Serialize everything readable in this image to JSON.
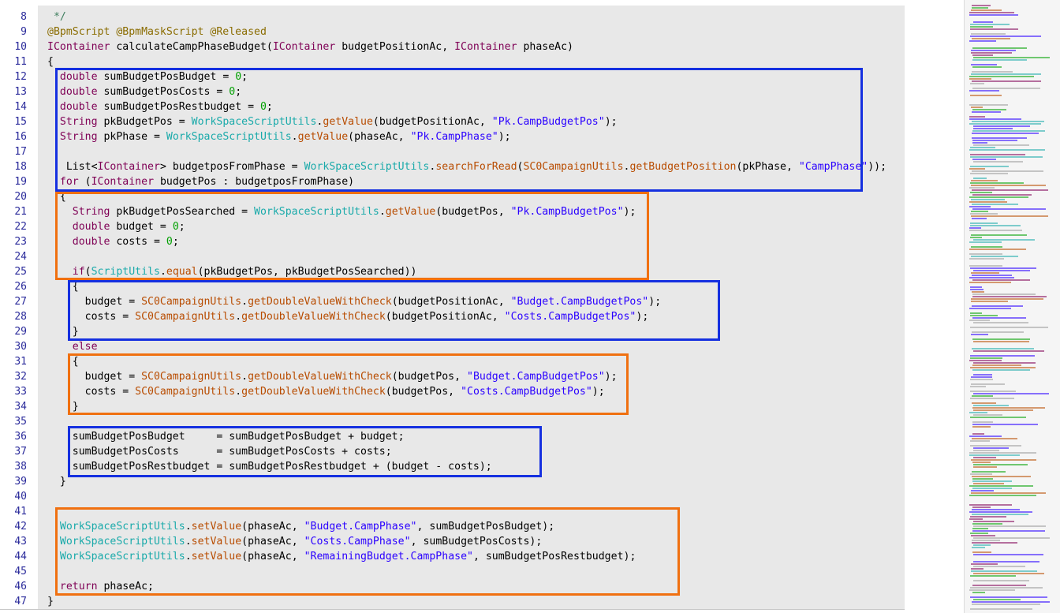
{
  "colors": {
    "background": "#e8e8e8",
    "keyword": "#7f0055",
    "number": "#00a000",
    "string": "#2a00ff",
    "utilClass": "#1aaaaa",
    "campaignClass": "#b84c00",
    "annotation": "#8a6c00",
    "highlightBlue": "#1530e0",
    "highlightOrange": "#f07010"
  },
  "lines": [
    {
      "n": "8",
      "tokens": [
        {
          "t": " */",
          "c": "cmt"
        }
      ]
    },
    {
      "n": "9",
      "tokens": [
        {
          "t": "@BpmScript @BpmMaskScript @Released",
          "c": "ann"
        }
      ]
    },
    {
      "n": "10",
      "tokens": [
        {
          "t": "IContainer",
          "c": "tp"
        },
        {
          "t": " calculateCampPhaseBudget(",
          "c": ""
        },
        {
          "t": "IContainer",
          "c": "tp"
        },
        {
          "t": " budgetPositionAc, ",
          "c": ""
        },
        {
          "t": "IContainer",
          "c": "tp"
        },
        {
          "t": " phaseAc)",
          "c": ""
        }
      ]
    },
    {
      "n": "11",
      "tokens": [
        {
          "t": "{",
          "c": ""
        }
      ]
    },
    {
      "n": "12",
      "tokens": [
        {
          "t": "  ",
          "c": ""
        },
        {
          "t": "double",
          "c": "kw"
        },
        {
          "t": " sumBudgetPosBudget = ",
          "c": ""
        },
        {
          "t": "0",
          "c": "num"
        },
        {
          "t": ";",
          "c": ""
        }
      ]
    },
    {
      "n": "13",
      "tokens": [
        {
          "t": "  ",
          "c": ""
        },
        {
          "t": "double",
          "c": "kw"
        },
        {
          "t": " sumBudgetPosCosts = ",
          "c": ""
        },
        {
          "t": "0",
          "c": "num"
        },
        {
          "t": ";",
          "c": ""
        }
      ]
    },
    {
      "n": "14",
      "tokens": [
        {
          "t": "  ",
          "c": ""
        },
        {
          "t": "double",
          "c": "kw"
        },
        {
          "t": " sumBudgetPosRestbudget = ",
          "c": ""
        },
        {
          "t": "0",
          "c": "num"
        },
        {
          "t": ";",
          "c": ""
        }
      ]
    },
    {
      "n": "15",
      "tokens": [
        {
          "t": "  ",
          "c": ""
        },
        {
          "t": "String",
          "c": "tp"
        },
        {
          "t": " pkBudgetPos = ",
          "c": ""
        },
        {
          "t": "WorkSpaceScriptUtils",
          "c": "cls"
        },
        {
          "t": ".",
          "c": ""
        },
        {
          "t": "getValue",
          "c": "cls2"
        },
        {
          "t": "(budgetPositionAc, ",
          "c": ""
        },
        {
          "t": "\"Pk.CampBudgetPos\"",
          "c": "str"
        },
        {
          "t": ");",
          "c": ""
        }
      ]
    },
    {
      "n": "16",
      "tokens": [
        {
          "t": "  ",
          "c": ""
        },
        {
          "t": "String",
          "c": "tp"
        },
        {
          "t": " pkPhase = ",
          "c": ""
        },
        {
          "t": "WorkSpaceScriptUtils",
          "c": "cls"
        },
        {
          "t": ".",
          "c": ""
        },
        {
          "t": "getValue",
          "c": "cls2"
        },
        {
          "t": "(phaseAc, ",
          "c": ""
        },
        {
          "t": "\"Pk.CampPhase\"",
          "c": "str"
        },
        {
          "t": ");",
          "c": ""
        }
      ]
    },
    {
      "n": "17",
      "tokens": []
    },
    {
      "n": "18",
      "tokens": [
        {
          "t": "   List<",
          "c": ""
        },
        {
          "t": "IContainer",
          "c": "tp"
        },
        {
          "t": "> budgetposFromPhase = ",
          "c": ""
        },
        {
          "t": "WorkSpaceScriptUtils",
          "c": "cls"
        },
        {
          "t": ".",
          "c": ""
        },
        {
          "t": "searchForRead",
          "c": "cls2"
        },
        {
          "t": "(",
          "c": ""
        },
        {
          "t": "SC0CampaignUtils",
          "c": "cls2"
        },
        {
          "t": ".",
          "c": ""
        },
        {
          "t": "getBudgetPosition",
          "c": "cls2"
        },
        {
          "t": "(pkPhase, ",
          "c": ""
        },
        {
          "t": "\"CampPhase\"",
          "c": "str"
        },
        {
          "t": "));",
          "c": ""
        }
      ]
    },
    {
      "n": "19",
      "tokens": [
        {
          "t": "  ",
          "c": ""
        },
        {
          "t": "for",
          "c": "kw"
        },
        {
          "t": " (",
          "c": ""
        },
        {
          "t": "IContainer",
          "c": "tp"
        },
        {
          "t": " budgetPos : budgetposFromPhase)",
          "c": ""
        }
      ]
    },
    {
      "n": "20",
      "tokens": [
        {
          "t": "  {",
          "c": ""
        }
      ]
    },
    {
      "n": "21",
      "tokens": [
        {
          "t": "    ",
          "c": ""
        },
        {
          "t": "String",
          "c": "tp"
        },
        {
          "t": " pkBudgetPosSearched = ",
          "c": ""
        },
        {
          "t": "WorkSpaceScriptUtils",
          "c": "cls"
        },
        {
          "t": ".",
          "c": ""
        },
        {
          "t": "getValue",
          "c": "cls2"
        },
        {
          "t": "(budgetPos, ",
          "c": ""
        },
        {
          "t": "\"Pk.CampBudgetPos\"",
          "c": "str"
        },
        {
          "t": ");",
          "c": ""
        }
      ]
    },
    {
      "n": "22",
      "tokens": [
        {
          "t": "    ",
          "c": ""
        },
        {
          "t": "double",
          "c": "kw"
        },
        {
          "t": " budget = ",
          "c": ""
        },
        {
          "t": "0",
          "c": "num"
        },
        {
          "t": ";",
          "c": ""
        }
      ]
    },
    {
      "n": "23",
      "tokens": [
        {
          "t": "    ",
          "c": ""
        },
        {
          "t": "double",
          "c": "kw"
        },
        {
          "t": " costs = ",
          "c": ""
        },
        {
          "t": "0",
          "c": "num"
        },
        {
          "t": ";",
          "c": ""
        }
      ]
    },
    {
      "n": "24",
      "tokens": []
    },
    {
      "n": "25",
      "tokens": [
        {
          "t": "    ",
          "c": ""
        },
        {
          "t": "if",
          "c": "kw"
        },
        {
          "t": "(",
          "c": ""
        },
        {
          "t": "ScriptUtils",
          "c": "cls"
        },
        {
          "t": ".",
          "c": ""
        },
        {
          "t": "equal",
          "c": "cls2"
        },
        {
          "t": "(pkBudgetPos, pkBudgetPosSearched))",
          "c": ""
        }
      ]
    },
    {
      "n": "26",
      "tokens": [
        {
          "t": "    {",
          "c": ""
        }
      ]
    },
    {
      "n": "27",
      "tokens": [
        {
          "t": "      budget = ",
          "c": ""
        },
        {
          "t": "SC0CampaignUtils",
          "c": "cls2"
        },
        {
          "t": ".",
          "c": ""
        },
        {
          "t": "getDoubleValueWithCheck",
          "c": "cls2"
        },
        {
          "t": "(budgetPositionAc, ",
          "c": ""
        },
        {
          "t": "\"Budget.CampBudgetPos\"",
          "c": "str"
        },
        {
          "t": ");",
          "c": ""
        }
      ]
    },
    {
      "n": "28",
      "tokens": [
        {
          "t": "      costs = ",
          "c": ""
        },
        {
          "t": "SC0CampaignUtils",
          "c": "cls2"
        },
        {
          "t": ".",
          "c": ""
        },
        {
          "t": "getDoubleValueWithCheck",
          "c": "cls2"
        },
        {
          "t": "(budgetPositionAc, ",
          "c": ""
        },
        {
          "t": "\"Costs.CampBudgetPos\"",
          "c": "str"
        },
        {
          "t": ");",
          "c": ""
        }
      ]
    },
    {
      "n": "29",
      "tokens": [
        {
          "t": "    }",
          "c": ""
        }
      ]
    },
    {
      "n": "30",
      "tokens": [
        {
          "t": "    ",
          "c": ""
        },
        {
          "t": "else",
          "c": "kw"
        }
      ]
    },
    {
      "n": "31",
      "tokens": [
        {
          "t": "    {",
          "c": ""
        }
      ]
    },
    {
      "n": "32",
      "tokens": [
        {
          "t": "      budget = ",
          "c": ""
        },
        {
          "t": "SC0CampaignUtils",
          "c": "cls2"
        },
        {
          "t": ".",
          "c": ""
        },
        {
          "t": "getDoubleValueWithCheck",
          "c": "cls2"
        },
        {
          "t": "(budgetPos, ",
          "c": ""
        },
        {
          "t": "\"Budget.CampBudgetPos\"",
          "c": "str"
        },
        {
          "t": ");",
          "c": ""
        }
      ]
    },
    {
      "n": "33",
      "tokens": [
        {
          "t": "      costs = ",
          "c": ""
        },
        {
          "t": "SC0CampaignUtils",
          "c": "cls2"
        },
        {
          "t": ".",
          "c": ""
        },
        {
          "t": "getDoubleValueWithCheck",
          "c": "cls2"
        },
        {
          "t": "(budgetPos, ",
          "c": ""
        },
        {
          "t": "\"Costs.CampBudgetPos\"",
          "c": "str"
        },
        {
          "t": ");",
          "c": ""
        }
      ]
    },
    {
      "n": "34",
      "tokens": [
        {
          "t": "    }",
          "c": ""
        }
      ]
    },
    {
      "n": "35",
      "tokens": []
    },
    {
      "n": "36",
      "tokens": [
        {
          "t": "    sumBudgetPosBudget     = sumBudgetPosBudget + budget;",
          "c": ""
        }
      ]
    },
    {
      "n": "37",
      "tokens": [
        {
          "t": "    sumBudgetPosCosts      = sumBudgetPosCosts + costs;",
          "c": ""
        }
      ]
    },
    {
      "n": "38",
      "tokens": [
        {
          "t": "    sumBudgetPosRestbudget = sumBudgetPosRestbudget + (budget - costs);",
          "c": ""
        }
      ]
    },
    {
      "n": "39",
      "tokens": [
        {
          "t": "  }",
          "c": ""
        }
      ]
    },
    {
      "n": "40",
      "tokens": []
    },
    {
      "n": "41",
      "tokens": []
    },
    {
      "n": "42",
      "tokens": [
        {
          "t": "  ",
          "c": ""
        },
        {
          "t": "WorkSpaceScriptUtils",
          "c": "cls"
        },
        {
          "t": ".",
          "c": ""
        },
        {
          "t": "setValue",
          "c": "cls2"
        },
        {
          "t": "(phaseAc, ",
          "c": ""
        },
        {
          "t": "\"Budget.CampPhase\"",
          "c": "str"
        },
        {
          "t": ", sumBudgetPosBudget);",
          "c": ""
        }
      ]
    },
    {
      "n": "43",
      "tokens": [
        {
          "t": "  ",
          "c": ""
        },
        {
          "t": "WorkSpaceScriptUtils",
          "c": "cls"
        },
        {
          "t": ".",
          "c": ""
        },
        {
          "t": "setValue",
          "c": "cls2"
        },
        {
          "t": "(phaseAc, ",
          "c": ""
        },
        {
          "t": "\"Costs.CampPhase\"",
          "c": "str"
        },
        {
          "t": ", sumBudgetPosCosts);",
          "c": ""
        }
      ]
    },
    {
      "n": "44",
      "tokens": [
        {
          "t": "  ",
          "c": ""
        },
        {
          "t": "WorkSpaceScriptUtils",
          "c": "cls"
        },
        {
          "t": ".",
          "c": ""
        },
        {
          "t": "setValue",
          "c": "cls2"
        },
        {
          "t": "(phaseAc, ",
          "c": ""
        },
        {
          "t": "\"RemainingBudget.CampPhase\"",
          "c": "str"
        },
        {
          "t": ", sumBudgetPosRestbudget);",
          "c": ""
        }
      ]
    },
    {
      "n": "45",
      "tokens": []
    },
    {
      "n": "46",
      "tokens": [
        {
          "t": "  ",
          "c": ""
        },
        {
          "t": "return",
          "c": "kw"
        },
        {
          "t": " phaseAc;",
          "c": ""
        }
      ]
    },
    {
      "n": "47",
      "tokens": [
        {
          "t": "}",
          "c": ""
        }
      ]
    }
  ]
}
